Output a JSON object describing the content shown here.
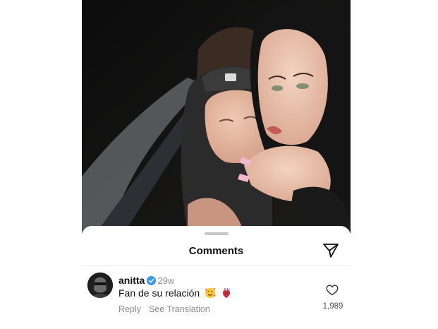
{
  "sheet": {
    "title": "Comments",
    "share_icon": "paper-plane-icon"
  },
  "comment": {
    "username": "anitta",
    "verified_icon": "verified-badge-icon",
    "age": "29w",
    "text": "Fan de su relación",
    "emojis": [
      "smiling-face-with-hearts-emoji",
      "anatomical-heart-emoji"
    ],
    "reply_label": "Reply",
    "translate_label": "See Translation",
    "like_icon": "heart-outline-icon",
    "like_count": "1,989"
  },
  "colors": {
    "verified_blue": "#3897f0",
    "secondary_text": "#8e8e8e"
  }
}
